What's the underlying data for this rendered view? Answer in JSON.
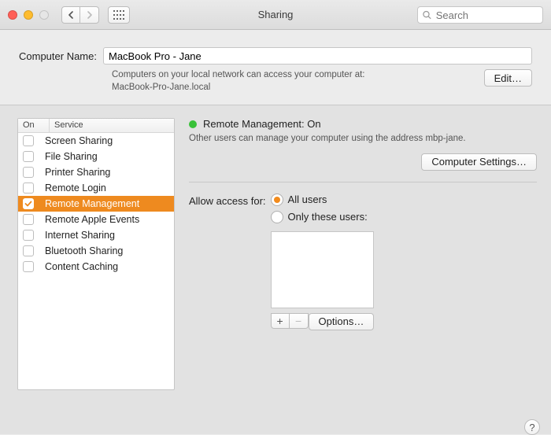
{
  "window": {
    "title": "Sharing",
    "search_placeholder": "Search"
  },
  "computer_name": {
    "label": "Computer Name:",
    "value": "MacBook Pro - Jane",
    "subtext_line1": "Computers on your local network can access your computer at:",
    "subtext_line2": "MacBook-Pro-Jane.local",
    "edit_button": "Edit…"
  },
  "services": {
    "header_on": "On",
    "header_service": "Service",
    "items": [
      {
        "label": "Screen Sharing",
        "checked": false,
        "selected": false
      },
      {
        "label": "File Sharing",
        "checked": false,
        "selected": false
      },
      {
        "label": "Printer Sharing",
        "checked": false,
        "selected": false
      },
      {
        "label": "Remote Login",
        "checked": false,
        "selected": false
      },
      {
        "label": "Remote Management",
        "checked": true,
        "selected": true
      },
      {
        "label": "Remote Apple Events",
        "checked": false,
        "selected": false
      },
      {
        "label": "Internet Sharing",
        "checked": false,
        "selected": false
      },
      {
        "label": "Bluetooth Sharing",
        "checked": false,
        "selected": false
      },
      {
        "label": "Content Caching",
        "checked": false,
        "selected": false
      }
    ]
  },
  "detail": {
    "status_title": "Remote Management: On",
    "status_color": "#39c139",
    "description": "Other users can manage your computer using the address mbp-jane.",
    "computer_settings_button": "Computer Settings…",
    "access_label": "Allow access for:",
    "radio_all": "All users",
    "radio_only": "Only these users:",
    "selected_radio": "all",
    "add_label": "+",
    "remove_label": "−",
    "options_button": "Options…"
  },
  "help_label": "?"
}
